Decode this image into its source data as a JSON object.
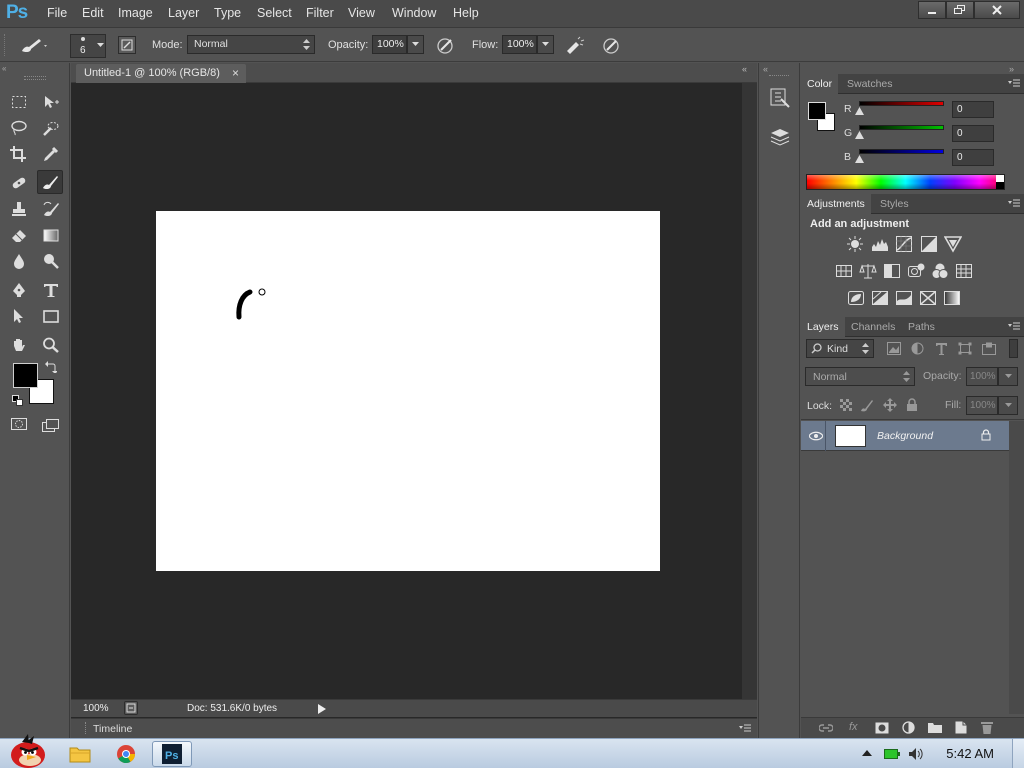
{
  "app": {
    "logo": "Ps"
  },
  "menu": [
    "File",
    "Edit",
    "Image",
    "Layer",
    "Type",
    "Select",
    "Filter",
    "View",
    "Window",
    "Help"
  ],
  "options": {
    "brush_size": "6",
    "mode_label": "Mode:",
    "mode_value": "Normal",
    "opacity_label": "Opacity:",
    "opacity_value": "100%",
    "flow_label": "Flow:",
    "flow_value": "100%"
  },
  "document": {
    "tab_title": "Untitled-1 @ 100% (RGB/8)",
    "close_glyph": "×",
    "zoom": "100%",
    "doc_info": "Doc: 531.6K/0 bytes",
    "timeline_label": "Timeline"
  },
  "color_panel": {
    "tabs": [
      "Color",
      "Swatches"
    ],
    "channels": [
      {
        "label": "R",
        "value": "0",
        "color": "#e00000"
      },
      {
        "label": "G",
        "value": "0",
        "color": "#00c000"
      },
      {
        "label": "B",
        "value": "0",
        "color": "#0000e0"
      }
    ]
  },
  "adjustments_panel": {
    "tabs": [
      "Adjustments",
      "Styles"
    ],
    "heading": "Add an adjustment"
  },
  "layers_panel": {
    "tabs": [
      "Layers",
      "Channels",
      "Paths"
    ],
    "filter_kind": "Kind",
    "blend_mode": "Normal",
    "opacity_label": "Opacity:",
    "opacity_value": "100%",
    "lock_label": "Lock:",
    "fill_label": "Fill:",
    "fill_value": "100%",
    "layers": [
      {
        "name": "Background"
      }
    ]
  },
  "taskbar": {
    "time": "5:42 AM"
  }
}
